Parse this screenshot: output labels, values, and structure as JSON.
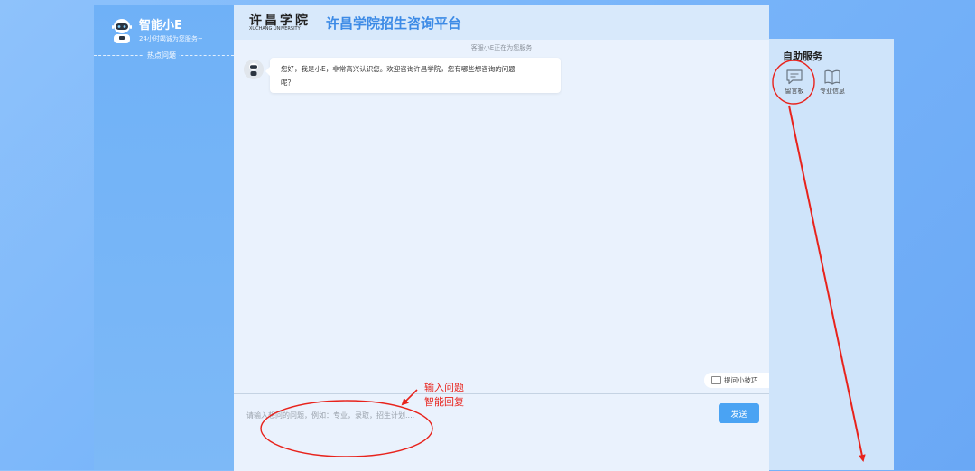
{
  "sidebar": {
    "bot_name": "智能小E",
    "bot_subtitle": "24小时竭诚为您服务~",
    "hot_questions_label": "热点问题"
  },
  "header": {
    "logo_cn": "许昌学院",
    "logo_en": "XUCHANG UNIVERSITY",
    "title": "许昌学院招生咨询平台"
  },
  "chat": {
    "service_notice": "客服小E正在为您服务",
    "messages": [
      {
        "sender": "bot",
        "text_line1": "您好，我是小E，非常高兴认识您。欢迎咨询许昌学院，您有哪些想咨询的问题",
        "text_line2": "呢？"
      }
    ]
  },
  "input": {
    "placeholder": "请输入想问的问题，例如：专业，录取，招生计划....",
    "value": "",
    "send_label": "发送",
    "tips_label": "提问小技巧"
  },
  "self_service": {
    "title": "自助服务",
    "tools": [
      {
        "label": "留言板",
        "icon": "message-board-icon"
      },
      {
        "label": "专业信息",
        "icon": "book-icon"
      }
    ]
  },
  "annotation": {
    "line1": "输入问题",
    "line2": "智能回复"
  },
  "colors": {
    "accent": "#4aa3f3",
    "title_blue": "#3d8be6",
    "annotation_red": "#e8231c"
  }
}
